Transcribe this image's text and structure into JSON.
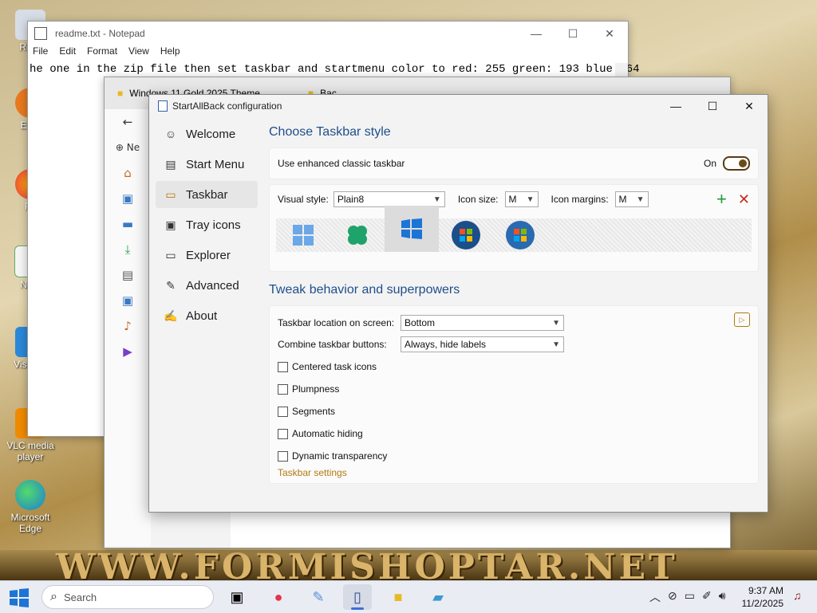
{
  "desktop": {
    "icons": [
      {
        "label": "Recy"
      },
      {
        "label": "Ever"
      },
      {
        "label": "Fir"
      },
      {
        "label": "Note"
      },
      {
        "label": "Visua C"
      },
      {
        "label": "VLC media player"
      },
      {
        "label": "Microsoft Edge"
      }
    ],
    "watermark": "WWW.FORMISHOPTAR.NET"
  },
  "notepad": {
    "title": "readme.txt - Notepad",
    "menu": [
      "File",
      "Edit",
      "Format",
      "View",
      "Help"
    ],
    "text": "he one in the zip file then set taskbar and startmenu color to red: 255 green: 193 blue: 64"
  },
  "explorer": {
    "tab1": "Windows 11 Gold 2025 Theme",
    "tab2": "Bac",
    "new_label": "Ne"
  },
  "sab": {
    "title": "StartAllBack configuration",
    "nav": [
      {
        "label": "Welcome",
        "icon": "smile-icon"
      },
      {
        "label": "Start Menu",
        "icon": "start-menu-icon"
      },
      {
        "label": "Taskbar",
        "icon": "taskbar-icon"
      },
      {
        "label": "Tray icons",
        "icon": "tray-icon"
      },
      {
        "label": "Explorer",
        "icon": "folder-icon"
      },
      {
        "label": "Advanced",
        "icon": "wrench-icon"
      },
      {
        "label": "About",
        "icon": "signature-icon"
      }
    ],
    "section1_title": "Choose Taskbar style",
    "enhanced_label": "Use enhanced classic taskbar",
    "enhanced_state": "On",
    "visual_style_label": "Visual style:",
    "visual_style_value": "Plain8",
    "icon_size_label": "Icon size:",
    "icon_size_value": "M",
    "icon_margins_label": "Icon margins:",
    "icon_margins_value": "M",
    "section2_title": "Tweak behavior and superpowers",
    "location_label": "Taskbar location on screen:",
    "location_value": "Bottom",
    "combine_label": "Combine taskbar buttons:",
    "combine_value": "Always, hide labels",
    "checkboxes": [
      {
        "label": "Centered task icons",
        "checked": false
      },
      {
        "label": "Plumpness",
        "checked": false
      },
      {
        "label": "Segments",
        "checked": false
      },
      {
        "label": "Automatic hiding",
        "checked": false
      },
      {
        "label": "Dynamic transparency",
        "checked": false
      }
    ],
    "settings_link": "Taskbar settings"
  },
  "taskbar": {
    "search_placeholder": "Search",
    "time": "9:37 AM",
    "date": "11/2/2025"
  },
  "colors": {
    "accent_green": "#1e9c3a",
    "accent_red": "#c42b1c",
    "heading_blue": "#1f4e8c",
    "link_brown": "#b07a12"
  }
}
